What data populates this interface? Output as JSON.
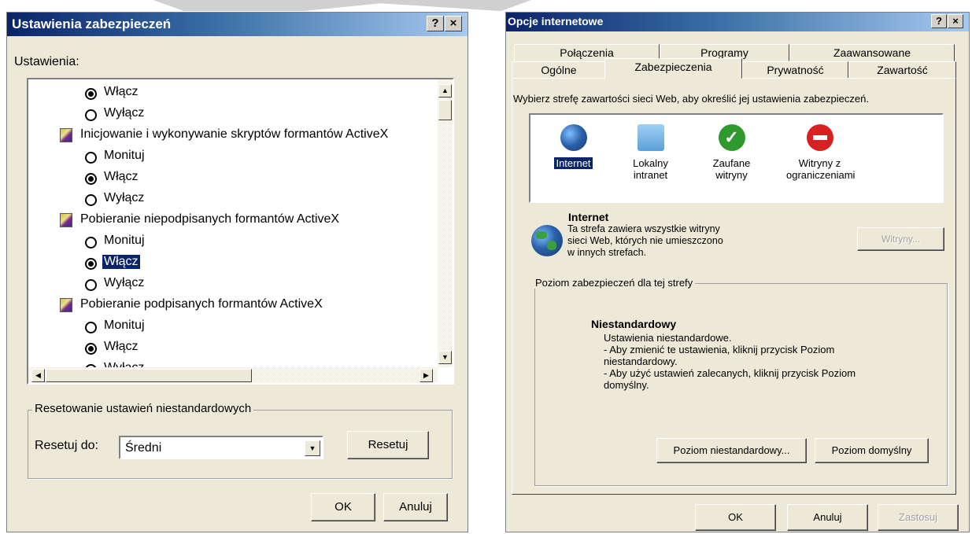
{
  "left_dialog": {
    "title": "Ustawienia zabezpieczeń",
    "help_btn": "?",
    "close_btn": "×",
    "settings_label": "Ustawienia:",
    "items": [
      {
        "type": "radio",
        "text": "Włącz",
        "checked": true,
        "selected": false
      },
      {
        "type": "radio",
        "text": "Wyłącz",
        "checked": false,
        "selected": false
      },
      {
        "type": "header",
        "text": "Inicjowanie i wykonywanie skryptów formantów ActiveX"
      },
      {
        "type": "radio",
        "text": "Monituj",
        "checked": false,
        "selected": false
      },
      {
        "type": "radio",
        "text": "Włącz",
        "checked": true,
        "selected": false
      },
      {
        "type": "radio",
        "text": "Wyłącz",
        "checked": false,
        "selected": false
      },
      {
        "type": "header",
        "text": "Pobieranie niepodpisanych formantów ActiveX"
      },
      {
        "type": "radio",
        "text": "Monituj",
        "checked": false,
        "selected": false
      },
      {
        "type": "radio",
        "text": "Włącz",
        "checked": true,
        "selected": true
      },
      {
        "type": "radio",
        "text": "Wyłącz",
        "checked": false,
        "selected": false
      },
      {
        "type": "header",
        "text": "Pobieranie podpisanych formantów ActiveX"
      },
      {
        "type": "radio",
        "text": "Monituj",
        "checked": false,
        "selected": false
      },
      {
        "type": "radio",
        "text": "Włącz",
        "checked": true,
        "selected": false
      },
      {
        "type": "radio",
        "text": "Wyłącz",
        "checked": false,
        "selected": false
      }
    ],
    "reset_group_label": "Resetowanie ustawień niestandardowych",
    "reset_to_label": "Resetuj do:",
    "reset_select_value": "Średni",
    "reset_button": "Resetuj",
    "ok_button": "OK",
    "cancel_button": "Anuluj"
  },
  "right_dialog": {
    "title": "Opcje internetowe",
    "help_btn": "?",
    "close_btn": "×",
    "tabs_back": [
      "Połączenia",
      "Programy",
      "Zaawansowane"
    ],
    "tabs_front": [
      "Ogólne",
      "Zabezpieczenia",
      "Prywatność",
      "Zawartość"
    ],
    "instruction": "Wybierz strefę zawartości sieci Web, aby określić jej ustawienia zabezpieczeń.",
    "zones": [
      {
        "line1": "Internet",
        "line2": "",
        "icon": "globe-icon",
        "color": "#2a5fa8"
      },
      {
        "line1": "Lokalny",
        "line2": "intranet",
        "icon": "computer-icon",
        "color": "#5aa0d8"
      },
      {
        "line1": "Zaufane",
        "line2": "witryny",
        "icon": "checkmark-icon",
        "color": "#2e9a2e"
      },
      {
        "line1": "Witryny z",
        "line2": "ograniczeniami",
        "icon": "no-entry-icon",
        "color": "#d82020"
      }
    ],
    "zone_title": "Internet",
    "zone_desc": "Ta strefa zawiera wszystkie witryny sieci Web, których nie umieszczono w innych strefach.",
    "sites_button": "Witryny...",
    "level_group_label": "Poziom zabezpieczeń dla tej strefy",
    "level_title": "Niestandardowy",
    "level_lines": [
      "Ustawienia niestandardowe.",
      "- Aby zmienić te ustawienia, kliknij przycisk Poziom niestandardowy.",
      "- Aby użyć ustawień zalecanych, kliknij przycisk Poziom domyślny."
    ],
    "custom_level_button": "Poziom niestandardowy...",
    "default_level_button": "Poziom domyślny",
    "ok_button": "OK",
    "cancel_button": "Anuluj",
    "apply_button": "Zastosuj"
  }
}
